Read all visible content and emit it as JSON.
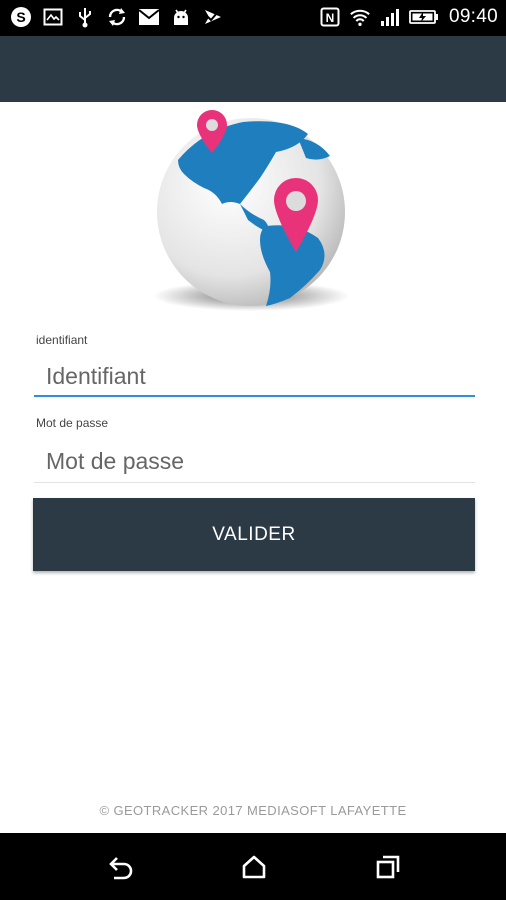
{
  "status_bar": {
    "time": "09:40",
    "left_icons": [
      "skype-icon",
      "image-icon",
      "usb-icon",
      "sync-icon",
      "mail-icon",
      "android-icon",
      "check-icon"
    ],
    "right_icons": [
      "nfc-icon",
      "wifi-icon",
      "signal-icon",
      "battery-icon"
    ]
  },
  "login": {
    "username_label": "identifiant",
    "username_placeholder": "Identifiant",
    "password_label": "Mot de passe",
    "password_placeholder": "Mot de passe",
    "submit_label": "VALIDER"
  },
  "footer": {
    "text": "© GEOTRACKER  2017  MEDIASOFT LAFAYETTE"
  },
  "colors": {
    "app_bar": "#2c3a46",
    "accent": "#2f8ee0",
    "pin": "#e8337a",
    "globe_blue": "#1f7fbe"
  },
  "nav_bar": {
    "icons": [
      "back-icon",
      "home-icon",
      "recents-icon"
    ]
  }
}
